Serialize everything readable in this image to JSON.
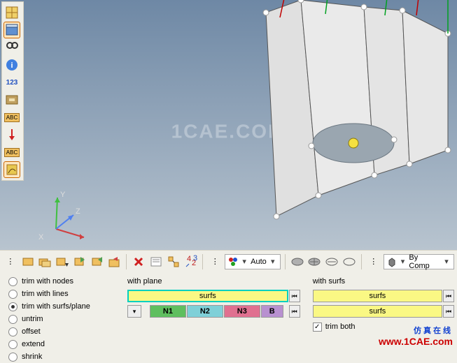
{
  "viewport": {
    "watermark": "1CAE.COM",
    "axes": {
      "x": "X",
      "y": "Y",
      "z": "Z"
    }
  },
  "left_tools": {
    "collectors": "collectors",
    "model_browser": "model-browser",
    "find": "find",
    "info": "info",
    "numbers": "123",
    "display_by_comp": "display",
    "label_abc": "ABC",
    "label_abc2": "ABC",
    "visualize": "visualize"
  },
  "toolbar": {
    "auto_label": "Auto",
    "bycomp_label": "By Comp"
  },
  "panel": {
    "radios": {
      "nodes": "trim with nodes",
      "lines": "trim with lines",
      "surfs_plane": "trim with surfs/plane",
      "untrim": "untrim",
      "offset": "offset",
      "extend": "extend",
      "shrink": "shrink"
    },
    "with_plane": {
      "title": "with plane",
      "surfs": "surfs",
      "n1": "N1",
      "n2": "N2",
      "n3": "N3",
      "b": "B"
    },
    "with_surfs": {
      "title": "with surfs",
      "surfs1": "surfs",
      "surfs2": "surfs",
      "trim_both": "trim both"
    },
    "selected_radio": "surfs_plane"
  },
  "footer": {
    "cn": "仿真在线",
    "url": "www.1CAE.com"
  }
}
